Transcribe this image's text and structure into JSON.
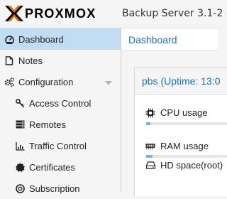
{
  "header": {
    "logo_text": "PROXMOX",
    "product": "Backup Server 3.1-2"
  },
  "sidebar": {
    "items": [
      {
        "label": "Dashboard",
        "icon": "dashboard-icon",
        "active": true
      },
      {
        "label": "Notes",
        "icon": "notes-icon"
      },
      {
        "label": "Configuration",
        "icon": "gears-icon",
        "expanded": true
      },
      {
        "label": "Access Control",
        "icon": "key-icon"
      },
      {
        "label": "Remotes",
        "icon": "server-icon"
      },
      {
        "label": "Traffic Control",
        "icon": "chart-icon"
      },
      {
        "label": "Certificates",
        "icon": "certificate-icon"
      },
      {
        "label": "Subscription",
        "icon": "support-icon"
      }
    ]
  },
  "main": {
    "tab_title": "Dashboard",
    "panel_title": "pbs (Uptime: 13:0",
    "stats": [
      {
        "label": "CPU usage",
        "icon": "cpu-icon",
        "usage_fraction": 0.05
      },
      {
        "label": "RAM usage",
        "icon": "memory-icon",
        "usage_fraction": 0.08
      },
      {
        "label": "HD space(root)",
        "icon": "hdd-icon"
      }
    ]
  },
  "colors": {
    "accent": "#1e6fb5",
    "active_nav_bg": "#c2ddf2",
    "logo_orange": "#e57000",
    "bar_fill": "#7ab2e0"
  }
}
